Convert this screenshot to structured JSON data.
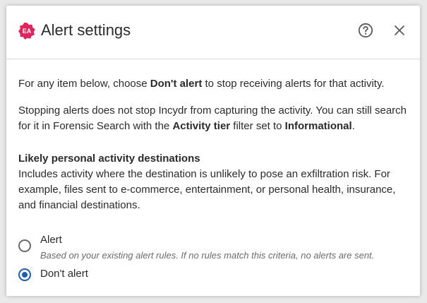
{
  "dialog": {
    "badge": "EA",
    "title": "Alert settings",
    "help_icon": "question-circle-icon",
    "close_icon": "close-icon",
    "badge_color": "#e0245e"
  },
  "intro": {
    "p1_prefix": "For any item below, choose ",
    "p1_bold": "Don't alert",
    "p1_suffix": " to stop receiving alerts for that activity.",
    "p2_prefix": "Stopping alerts does not stop Incydr from capturing the activity. You can still search for it in Forensic Search with the ",
    "p2_bold1": "Activity tier",
    "p2_mid": " filter set to ",
    "p2_bold2": "Informational",
    "p2_suffix": "."
  },
  "section": {
    "title": "Likely personal activity destinations",
    "description": "Includes activity where the destination is unlikely to pose an exfiltration risk. For example, files sent to e-commerce, entertainment, or personal health, insurance, and financial destinations."
  },
  "options": [
    {
      "label": "Alert",
      "hint": "Based on your existing alert rules. If no rules match this criteria, no alerts are sent.",
      "selected": false
    },
    {
      "label": "Don't alert",
      "hint": "",
      "selected": true
    }
  ],
  "colors": {
    "accent": "#1a5fb4",
    "text": "#2b2b2b",
    "muted": "#6b6b6b"
  }
}
